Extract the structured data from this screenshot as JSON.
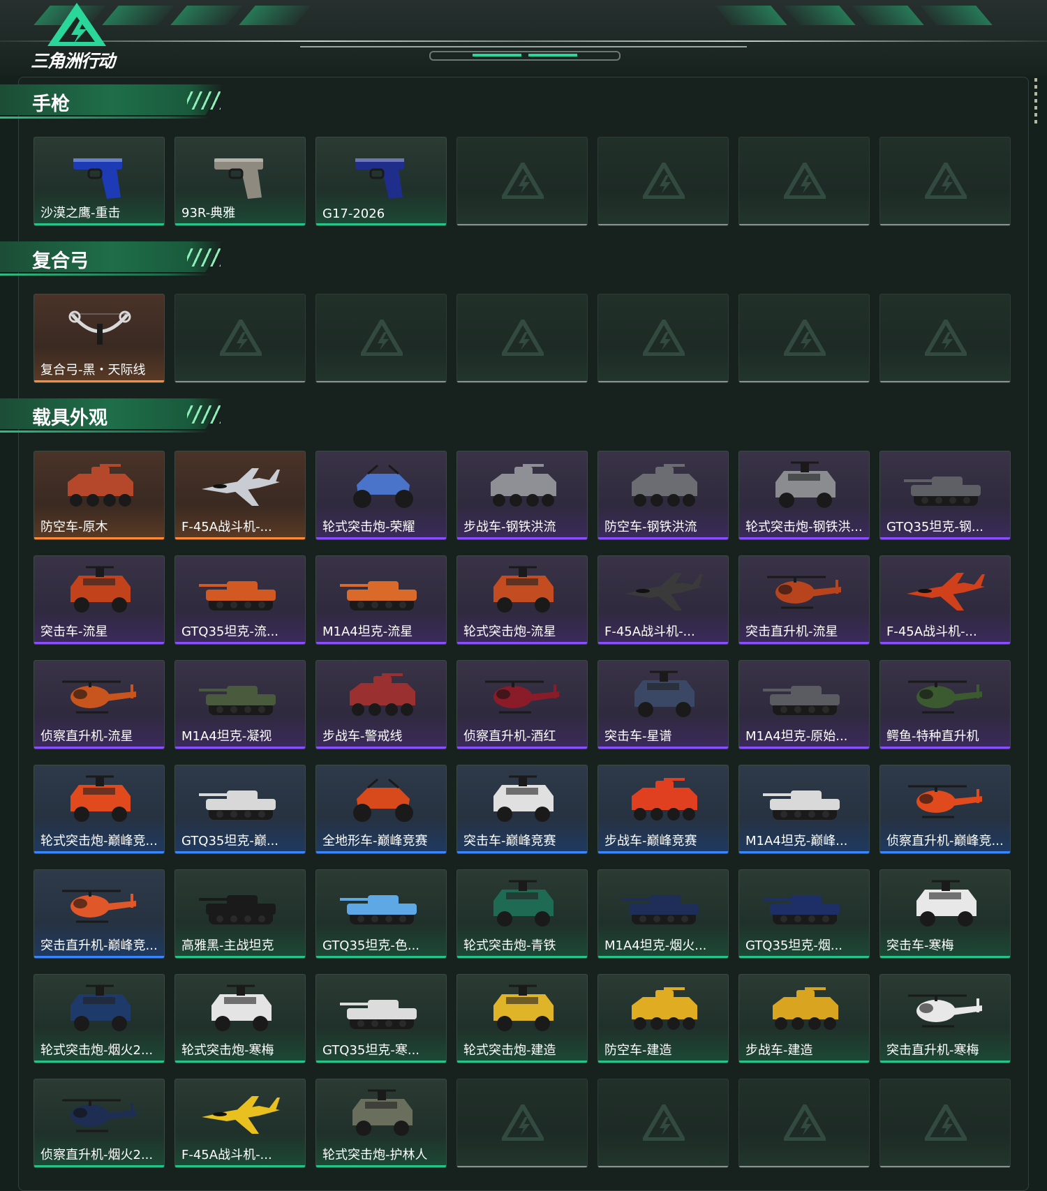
{
  "header": {
    "logo_text": "三角洲行动"
  },
  "sections": [
    {
      "title": "手枪",
      "items": [
        {
          "name": "沙漠之鹰-重击",
          "rarity": "green",
          "icon": "pistol-icon",
          "color": "#1c3bb5"
        },
        {
          "name": "93R-典雅",
          "rarity": "green",
          "icon": "pistol-icon",
          "color": "#8e8a80"
        },
        {
          "name": "G17-2026",
          "rarity": "green",
          "icon": "pistol-icon",
          "color": "#1e2e8a"
        },
        {
          "name": "",
          "rarity": "empty"
        },
        {
          "name": "",
          "rarity": "empty"
        },
        {
          "name": "",
          "rarity": "empty"
        },
        {
          "name": "",
          "rarity": "empty"
        }
      ]
    },
    {
      "title": "复合弓",
      "items": [
        {
          "name": "复合弓-黑・天际线",
          "rarity": "orange",
          "icon": "bow-icon",
          "color": "#d9d9d9"
        },
        {
          "name": "",
          "rarity": "empty"
        },
        {
          "name": "",
          "rarity": "empty"
        },
        {
          "name": "",
          "rarity": "empty"
        },
        {
          "name": "",
          "rarity": "empty"
        },
        {
          "name": "",
          "rarity": "empty"
        },
        {
          "name": "",
          "rarity": "empty"
        }
      ]
    },
    {
      "title": "载具外观",
      "items": [
        {
          "name": "防空车-原木",
          "rarity": "orange",
          "icon": "apc-icon",
          "color": "#b5482a"
        },
        {
          "name": "F-45A战斗机-...",
          "rarity": "orange",
          "icon": "jet-icon",
          "color": "#c9ccd2"
        },
        {
          "name": "轮式突击炮-荣耀",
          "rarity": "purple",
          "icon": "buggy-icon",
          "color": "#4a74c9"
        },
        {
          "name": "步战车-钢铁洪流",
          "rarity": "purple",
          "icon": "apc-icon",
          "color": "#8e9096"
        },
        {
          "name": "防空车-钢铁洪流",
          "rarity": "purple",
          "icon": "apc-icon",
          "color": "#6b6d72"
        },
        {
          "name": "轮式突击炮-钢铁洪...",
          "rarity": "purple",
          "icon": "truck-icon",
          "color": "#8a8c90"
        },
        {
          "name": "GTQ35坦克-钢...",
          "rarity": "purple",
          "icon": "tank-icon",
          "color": "#5e6066"
        },
        {
          "name": "突击车-流星",
          "rarity": "purple",
          "icon": "truck-icon",
          "color": "#c2421c"
        },
        {
          "name": "GTQ35坦克-流...",
          "rarity": "purple",
          "icon": "tank-icon",
          "color": "#d25a22"
        },
        {
          "name": "M1A4坦克-流星",
          "rarity": "purple",
          "icon": "tank-icon",
          "color": "#d96a2a"
        },
        {
          "name": "轮式突击炮-流星",
          "rarity": "purple",
          "icon": "truck-icon",
          "color": "#c34d20"
        },
        {
          "name": "F-45A战斗机-...",
          "rarity": "purple",
          "icon": "jet-icon",
          "color": "#3a3a3a"
        },
        {
          "name": "突击直升机-流星",
          "rarity": "purple",
          "icon": "heli-icon",
          "color": "#b8441e"
        },
        {
          "name": "F-45A战斗机-...",
          "rarity": "purple",
          "icon": "jet-icon",
          "color": "#d0401a"
        },
        {
          "name": "侦察直升机-流星",
          "rarity": "purple",
          "icon": "heli-icon",
          "color": "#c9551e"
        },
        {
          "name": "M1A4坦克-凝视",
          "rarity": "purple",
          "icon": "tank-icon",
          "color": "#4a5a3c"
        },
        {
          "name": "步战车-警戒线",
          "rarity": "purple",
          "icon": "apc-icon",
          "color": "#9a3030"
        },
        {
          "name": "侦察直升机-酒红",
          "rarity": "purple",
          "icon": "heli-icon",
          "color": "#8a1c2a"
        },
        {
          "name": "突击车-星谱",
          "rarity": "purple",
          "icon": "truck-icon",
          "color": "#3a4866"
        },
        {
          "name": "M1A4坦克-原始...",
          "rarity": "purple",
          "icon": "tank-icon",
          "color": "#5a5c62"
        },
        {
          "name": "鳄鱼-特种直升机",
          "rarity": "purple",
          "icon": "heli-icon",
          "color": "#3c5a30"
        },
        {
          "name": "轮式突击炮-巅峰竞...",
          "rarity": "blue",
          "icon": "truck-icon",
          "color": "#e04a1c"
        },
        {
          "name": "GTQ35坦克-巅...",
          "rarity": "blue",
          "icon": "tank-icon",
          "color": "#d8d8d8"
        },
        {
          "name": "全地形车-巅峰竞赛",
          "rarity": "blue",
          "icon": "buggy-icon",
          "color": "#d84a1c"
        },
        {
          "name": "突击车-巅峰竞赛",
          "rarity": "blue",
          "icon": "truck-icon",
          "color": "#e0e0e0"
        },
        {
          "name": "步战车-巅峰竞赛",
          "rarity": "blue",
          "icon": "apc-icon",
          "color": "#e04020"
        },
        {
          "name": "M1A4坦克-巅峰...",
          "rarity": "blue",
          "icon": "tank-icon",
          "color": "#d9d9d9"
        },
        {
          "name": "侦察直升机-巅峰竞...",
          "rarity": "blue",
          "icon": "heli-icon",
          "color": "#e04a1c"
        },
        {
          "name": "突击直升机-巅峰竞...",
          "rarity": "blue",
          "icon": "heli-icon",
          "color": "#e0582a"
        },
        {
          "name": "高雅黑-主战坦克",
          "rarity": "green",
          "icon": "tank-icon",
          "color": "#1a1a1a"
        },
        {
          "name": "GTQ35坦克-色...",
          "rarity": "green",
          "icon": "tank-icon",
          "color": "#5ea8e6"
        },
        {
          "name": "轮式突击炮-青铁",
          "rarity": "green",
          "icon": "truck-icon",
          "color": "#1e6a52"
        },
        {
          "name": "M1A4坦克-烟火...",
          "rarity": "green",
          "icon": "tank-icon",
          "color": "#1e2e58"
        },
        {
          "name": "GTQ35坦克-烟...",
          "rarity": "green",
          "icon": "tank-icon",
          "color": "#1e2e66"
        },
        {
          "name": "突击车-寒梅",
          "rarity": "green",
          "icon": "truck-icon",
          "color": "#e8e8e8"
        },
        {
          "name": "轮式突击炮-烟火2...",
          "rarity": "green",
          "icon": "truck-icon",
          "color": "#1e3a6a"
        },
        {
          "name": "轮式突击炮-寒梅",
          "rarity": "green",
          "icon": "truck-icon",
          "color": "#e4e4e4"
        },
        {
          "name": "GTQ35坦克-寒...",
          "rarity": "green",
          "icon": "tank-icon",
          "color": "#dcdcdc"
        },
        {
          "name": "轮式突击炮-建造",
          "rarity": "green",
          "icon": "truck-icon",
          "color": "#e0b428"
        },
        {
          "name": "防空车-建造",
          "rarity": "green",
          "icon": "apc-icon",
          "color": "#e0ac22"
        },
        {
          "name": "步战车-建造",
          "rarity": "green",
          "icon": "apc-icon",
          "color": "#d9a520"
        },
        {
          "name": "突击直升机-寒梅",
          "rarity": "green",
          "icon": "heli-icon",
          "color": "#e8e8e8"
        },
        {
          "name": "侦察直升机-烟火2...",
          "rarity": "green",
          "icon": "heli-icon",
          "color": "#1e2e52"
        },
        {
          "name": "F-45A战斗机-...",
          "rarity": "green",
          "icon": "jet-icon",
          "color": "#e8c020"
        },
        {
          "name": "轮式突击炮-护林人",
          "rarity": "green",
          "icon": "truck-icon",
          "color": "#6a6e5c"
        },
        {
          "name": "",
          "rarity": "empty"
        },
        {
          "name": "",
          "rarity": "empty"
        },
        {
          "name": "",
          "rarity": "empty"
        },
        {
          "name": "",
          "rarity": "empty"
        }
      ]
    }
  ]
}
